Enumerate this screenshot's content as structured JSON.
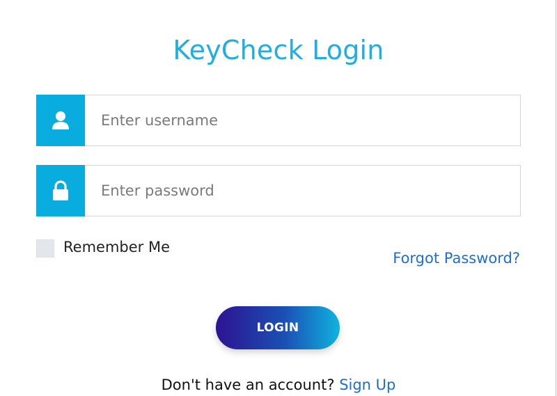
{
  "login_form": {
    "title": "KeyCheck Login",
    "username": {
      "placeholder": "Enter username",
      "value": "",
      "icon": "user-icon"
    },
    "password": {
      "placeholder": "Enter password",
      "value": "",
      "icon": "lock-icon"
    },
    "remember_me": {
      "label": "Remember Me",
      "checked": false
    },
    "forgot_password_label": "Forgot Password?",
    "login_button_label": "LOGIN",
    "signup_prompt": "Don't have an account?",
    "signup_link_label": "Sign Up"
  },
  "colors": {
    "title": "#1eaee0",
    "icon_box": "#08acde",
    "link": "#1a6fd1",
    "button_gradient_start": "#2d1391",
    "button_gradient_end": "#0fb3df"
  }
}
